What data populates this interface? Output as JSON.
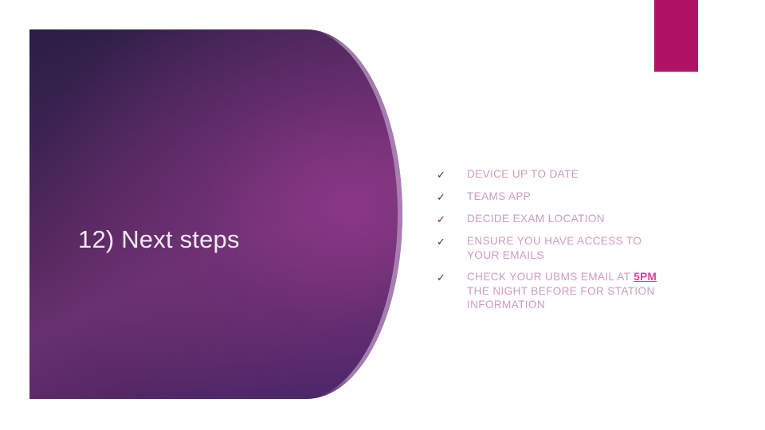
{
  "slide": {
    "title": "12) Next steps",
    "accent_color": "#b01265",
    "panel_colors": {
      "dark": "#2b1e45",
      "mid": "#67316f",
      "edge_highlight": "#af8cba"
    },
    "text_color": "#ce9bbe",
    "highlight_color": "#e33c93"
  },
  "bullets": {
    "marker": "✓",
    "items": [
      {
        "text": "DEVICE UP TO DATE"
      },
      {
        "text": "TEAMS APP"
      },
      {
        "text": "DECIDE EXAM LOCATION"
      },
      {
        "text": "ENSURE YOU HAVE ACCESS TO YOUR EMAILS"
      },
      {
        "text_before": "CHECK YOUR UBMS EMAIL AT ",
        "highlight": "5PM",
        "text_after": " THE NIGHT BEFORE FOR STATION INFORMATION"
      }
    ]
  }
}
